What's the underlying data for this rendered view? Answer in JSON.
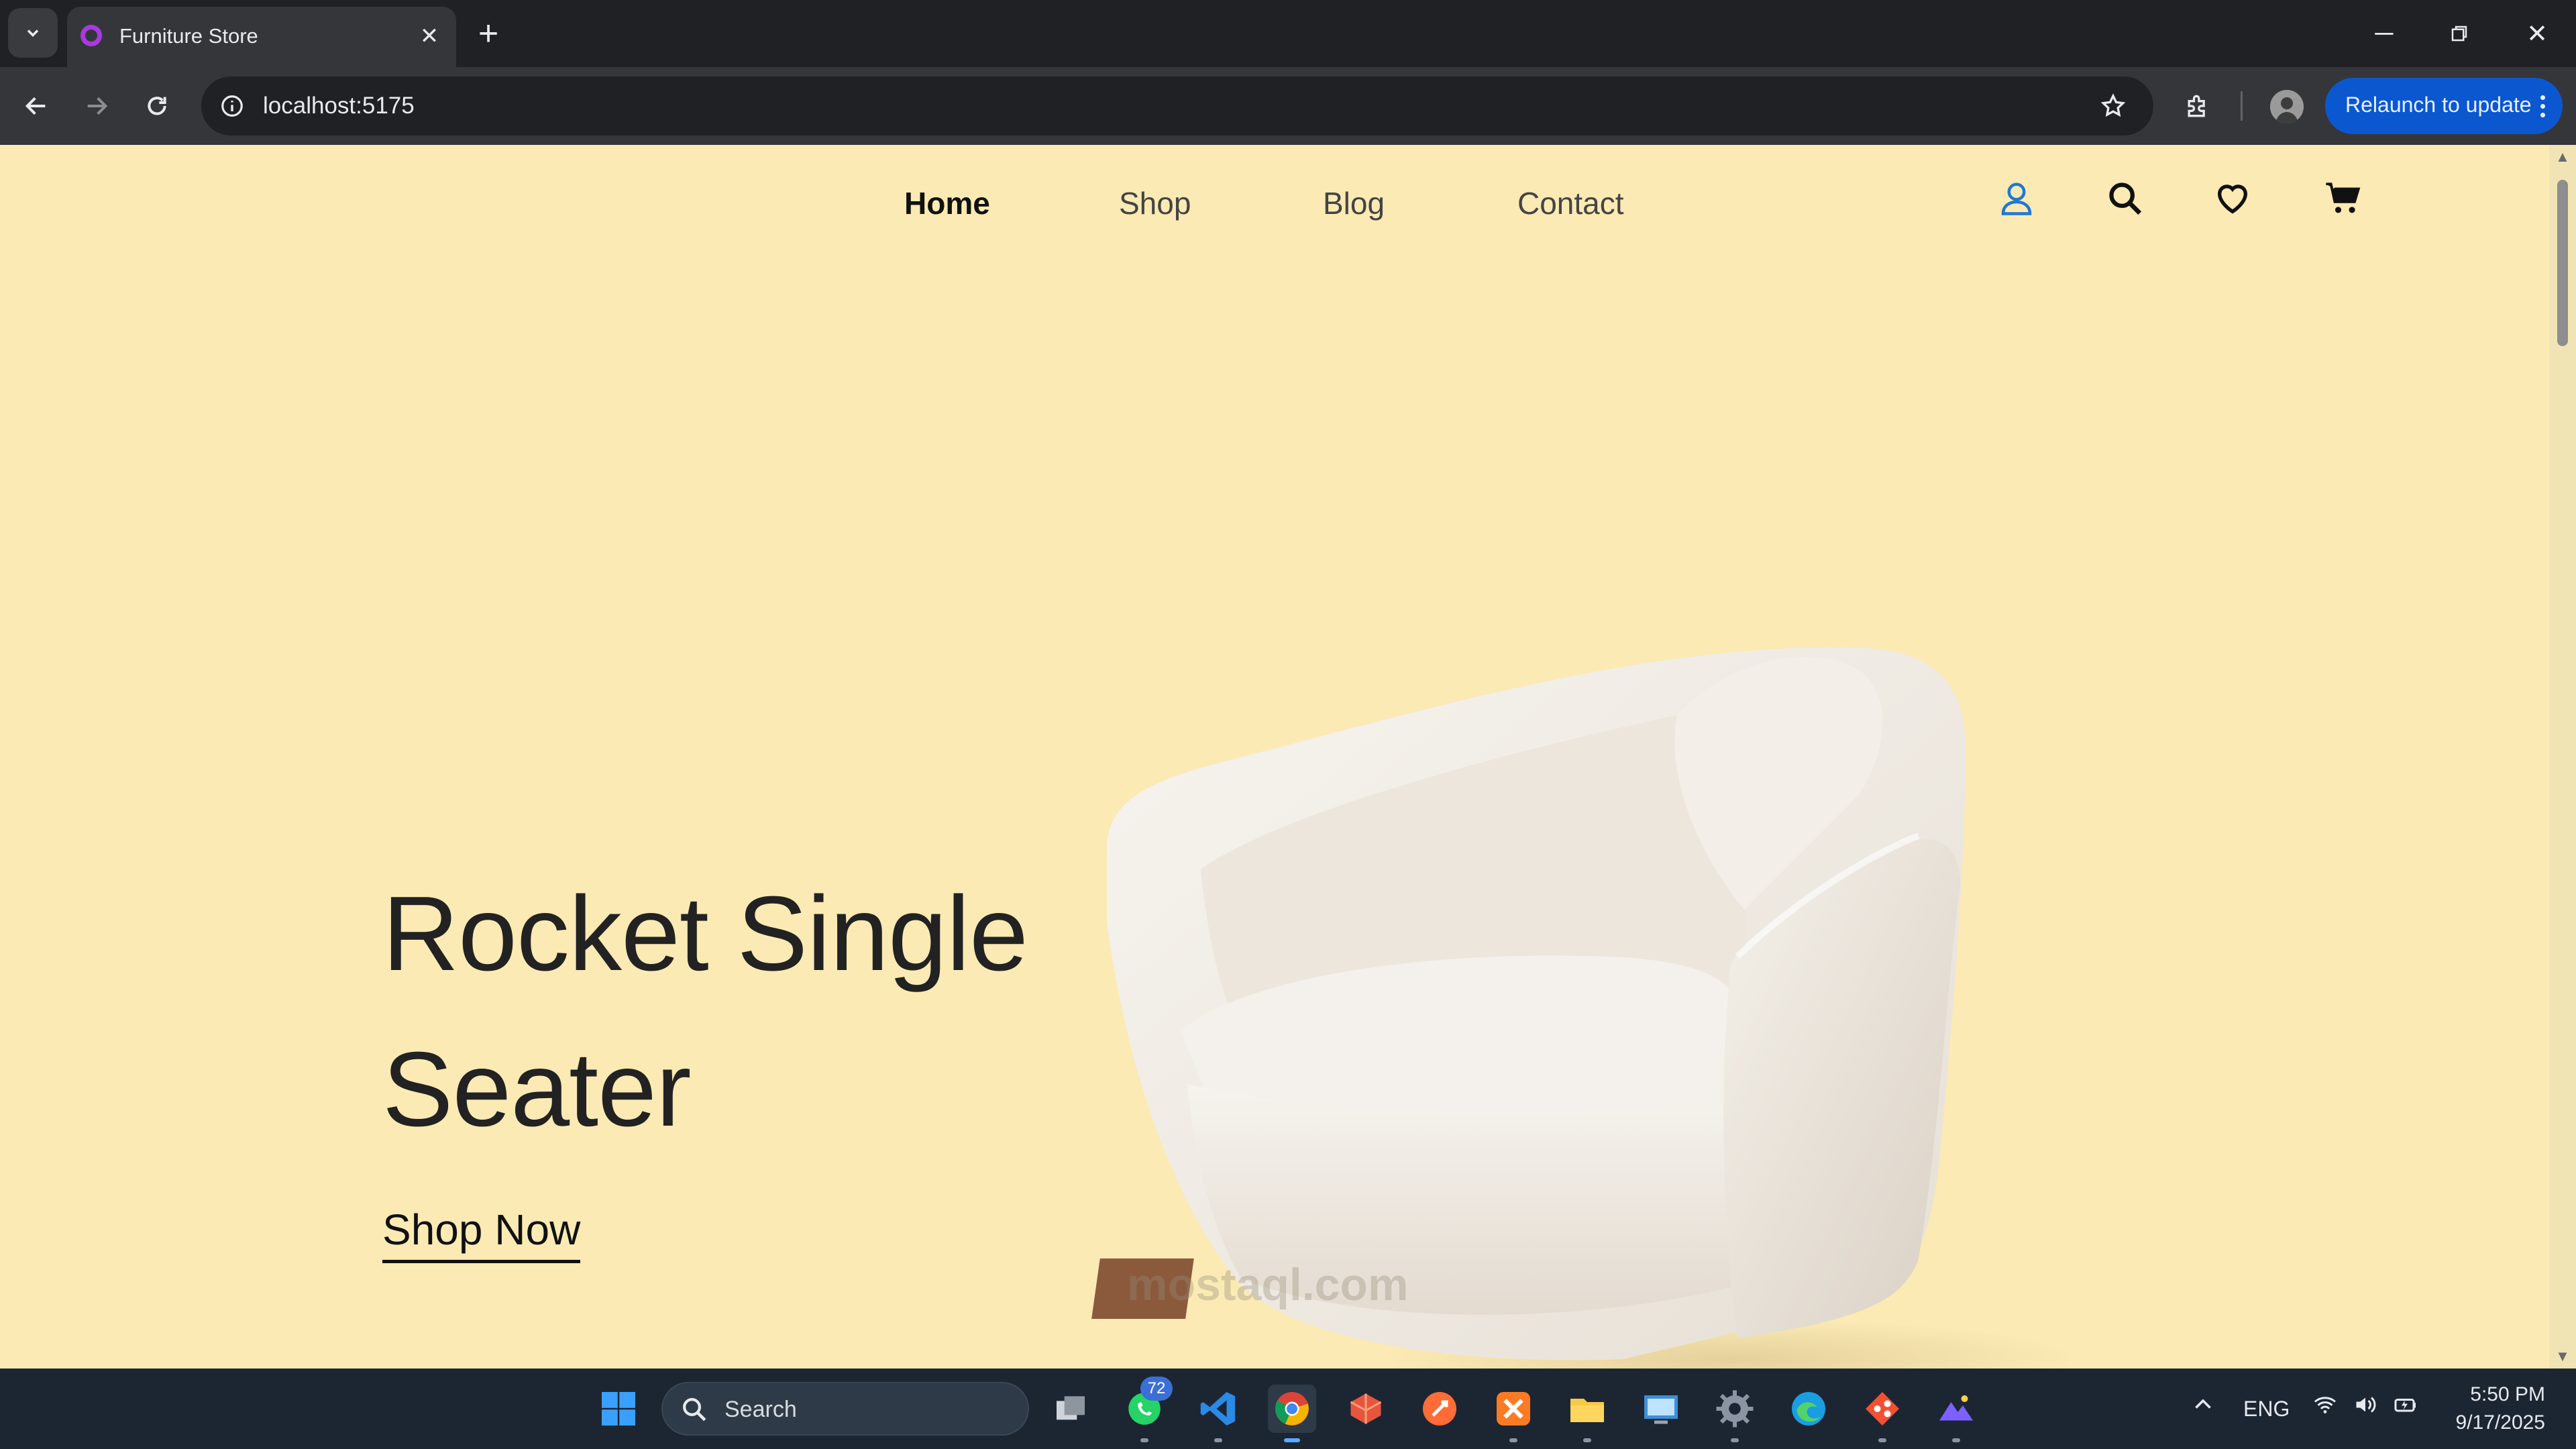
{
  "browser": {
    "tab_title": "Furniture Store",
    "url": "localhost:5175",
    "relaunch_label": "Relaunch to update"
  },
  "site": {
    "nav": [
      {
        "label": "Home",
        "active": true
      },
      {
        "label": "Shop",
        "active": false
      },
      {
        "label": "Blog",
        "active": false
      },
      {
        "label": "Contact",
        "active": false
      }
    ],
    "icons": [
      "user-icon",
      "search-icon",
      "heart-icon",
      "cart-icon"
    ],
    "hero": {
      "title_line1": "Rocket Single",
      "title_line2": "Seater",
      "cta": "Shop Now"
    },
    "watermark": "mostaql.com",
    "colors": {
      "background": "#fbeab4",
      "text": "#222222",
      "user_icon": "#1e78d6"
    }
  },
  "taskbar": {
    "search_label": "Search",
    "whatsapp_badge": "72",
    "language": "ENG",
    "time": "5:50 PM",
    "date": "9/17/2025"
  }
}
